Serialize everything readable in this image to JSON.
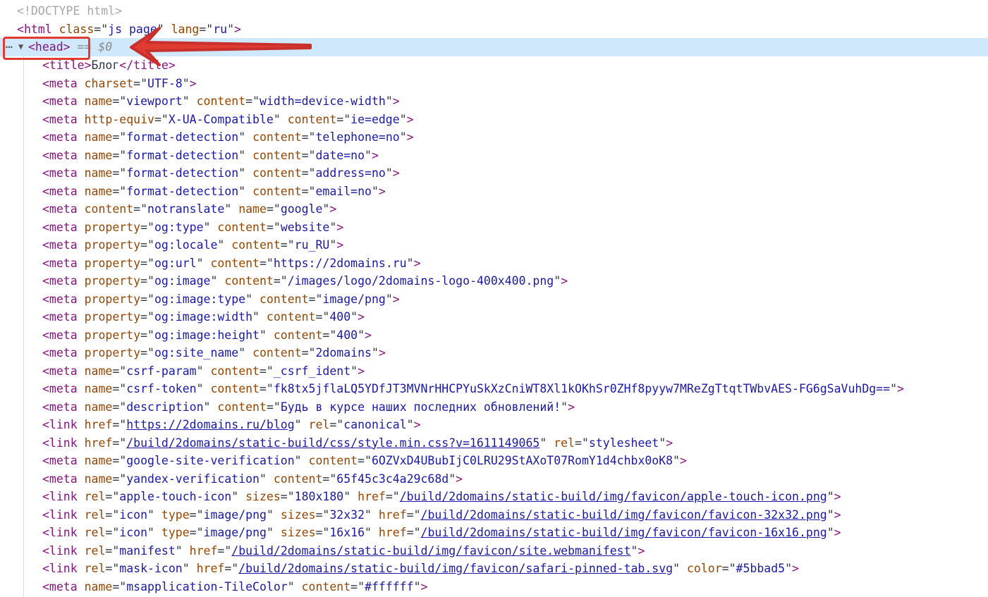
{
  "doctype": "<!DOCTYPE html>",
  "html_open": {
    "tag": "html",
    "class_value": "js page",
    "lang_value": "ru"
  },
  "head_node": {
    "tag": "<head>",
    "console_ref": "== $0"
  },
  "title_node": {
    "text": "Блог"
  },
  "nodes": [
    [
      [
        "t",
        "<meta "
      ],
      [
        "a",
        "charset"
      ],
      [
        "e",
        "=\""
      ],
      [
        "v",
        "UTF-8"
      ],
      [
        "e",
        "\""
      ],
      [
        "t",
        ">"
      ]
    ],
    [
      [
        "t",
        "<meta "
      ],
      [
        "a",
        "name"
      ],
      [
        "e",
        "=\""
      ],
      [
        "v",
        "viewport"
      ],
      [
        "e",
        "\" "
      ],
      [
        "a",
        "content"
      ],
      [
        "e",
        "=\""
      ],
      [
        "v",
        "width=device-width"
      ],
      [
        "e",
        "\""
      ],
      [
        "t",
        ">"
      ]
    ],
    [
      [
        "t",
        "<meta "
      ],
      [
        "a",
        "http-equiv"
      ],
      [
        "e",
        "=\""
      ],
      [
        "v",
        "X-UA-Compatible"
      ],
      [
        "e",
        "\" "
      ],
      [
        "a",
        "content"
      ],
      [
        "e",
        "=\""
      ],
      [
        "v",
        "ie=edge"
      ],
      [
        "e",
        "\""
      ],
      [
        "t",
        ">"
      ]
    ],
    [
      [
        "t",
        "<meta "
      ],
      [
        "a",
        "name"
      ],
      [
        "e",
        "=\""
      ],
      [
        "v",
        "format-detection"
      ],
      [
        "e",
        "\" "
      ],
      [
        "a",
        "content"
      ],
      [
        "e",
        "=\""
      ],
      [
        "v",
        "telephone=no"
      ],
      [
        "e",
        "\""
      ],
      [
        "t",
        ">"
      ]
    ],
    [
      [
        "t",
        "<meta "
      ],
      [
        "a",
        "name"
      ],
      [
        "e",
        "=\""
      ],
      [
        "v",
        "format-detection"
      ],
      [
        "e",
        "\" "
      ],
      [
        "a",
        "content"
      ],
      [
        "e",
        "=\""
      ],
      [
        "v",
        "date=no"
      ],
      [
        "e",
        "\""
      ],
      [
        "t",
        ">"
      ]
    ],
    [
      [
        "t",
        "<meta "
      ],
      [
        "a",
        "name"
      ],
      [
        "e",
        "=\""
      ],
      [
        "v",
        "format-detection"
      ],
      [
        "e",
        "\" "
      ],
      [
        "a",
        "content"
      ],
      [
        "e",
        "=\""
      ],
      [
        "v",
        "address=no"
      ],
      [
        "e",
        "\""
      ],
      [
        "t",
        ">"
      ]
    ],
    [
      [
        "t",
        "<meta "
      ],
      [
        "a",
        "name"
      ],
      [
        "e",
        "=\""
      ],
      [
        "v",
        "format-detection"
      ],
      [
        "e",
        "\" "
      ],
      [
        "a",
        "content"
      ],
      [
        "e",
        "=\""
      ],
      [
        "v",
        "email=no"
      ],
      [
        "e",
        "\""
      ],
      [
        "t",
        ">"
      ]
    ],
    [
      [
        "t",
        "<meta "
      ],
      [
        "a",
        "content"
      ],
      [
        "e",
        "=\""
      ],
      [
        "v",
        "notranslate"
      ],
      [
        "e",
        "\" "
      ],
      [
        "a",
        "name"
      ],
      [
        "e",
        "=\""
      ],
      [
        "v",
        "google"
      ],
      [
        "e",
        "\""
      ],
      [
        "t",
        ">"
      ]
    ],
    [
      [
        "t",
        "<meta "
      ],
      [
        "a",
        "property"
      ],
      [
        "e",
        "=\""
      ],
      [
        "v",
        "og:type"
      ],
      [
        "e",
        "\" "
      ],
      [
        "a",
        "content"
      ],
      [
        "e",
        "=\""
      ],
      [
        "v",
        "website"
      ],
      [
        "e",
        "\""
      ],
      [
        "t",
        ">"
      ]
    ],
    [
      [
        "t",
        "<meta "
      ],
      [
        "a",
        "property"
      ],
      [
        "e",
        "=\""
      ],
      [
        "v",
        "og:locale"
      ],
      [
        "e",
        "\" "
      ],
      [
        "a",
        "content"
      ],
      [
        "e",
        "=\""
      ],
      [
        "v",
        "ru_RU"
      ],
      [
        "e",
        "\""
      ],
      [
        "t",
        ">"
      ]
    ],
    [
      [
        "t",
        "<meta "
      ],
      [
        "a",
        "property"
      ],
      [
        "e",
        "=\""
      ],
      [
        "v",
        "og:url"
      ],
      [
        "e",
        "\" "
      ],
      [
        "a",
        "content"
      ],
      [
        "e",
        "=\""
      ],
      [
        "v",
        "https://2domains.ru"
      ],
      [
        "e",
        "\""
      ],
      [
        "t",
        ">"
      ]
    ],
    [
      [
        "t",
        "<meta "
      ],
      [
        "a",
        "property"
      ],
      [
        "e",
        "=\""
      ],
      [
        "v",
        "og:image"
      ],
      [
        "e",
        "\" "
      ],
      [
        "a",
        "content"
      ],
      [
        "e",
        "=\""
      ],
      [
        "v",
        "/images/logo/2domains-logo-400x400.png"
      ],
      [
        "e",
        "\""
      ],
      [
        "t",
        ">"
      ]
    ],
    [
      [
        "t",
        "<meta "
      ],
      [
        "a",
        "property"
      ],
      [
        "e",
        "=\""
      ],
      [
        "v",
        "og:image:type"
      ],
      [
        "e",
        "\" "
      ],
      [
        "a",
        "content"
      ],
      [
        "e",
        "=\""
      ],
      [
        "v",
        "image/png"
      ],
      [
        "e",
        "\""
      ],
      [
        "t",
        ">"
      ]
    ],
    [
      [
        "t",
        "<meta "
      ],
      [
        "a",
        "property"
      ],
      [
        "e",
        "=\""
      ],
      [
        "v",
        "og:image:width"
      ],
      [
        "e",
        "\" "
      ],
      [
        "a",
        "content"
      ],
      [
        "e",
        "=\""
      ],
      [
        "v",
        "400"
      ],
      [
        "e",
        "\""
      ],
      [
        "t",
        ">"
      ]
    ],
    [
      [
        "t",
        "<meta "
      ],
      [
        "a",
        "property"
      ],
      [
        "e",
        "=\""
      ],
      [
        "v",
        "og:image:height"
      ],
      [
        "e",
        "\" "
      ],
      [
        "a",
        "content"
      ],
      [
        "e",
        "=\""
      ],
      [
        "v",
        "400"
      ],
      [
        "e",
        "\""
      ],
      [
        "t",
        ">"
      ]
    ],
    [
      [
        "t",
        "<meta "
      ],
      [
        "a",
        "property"
      ],
      [
        "e",
        "=\""
      ],
      [
        "v",
        "og:site_name"
      ],
      [
        "e",
        "\" "
      ],
      [
        "a",
        "content"
      ],
      [
        "e",
        "=\""
      ],
      [
        "v",
        "2domains"
      ],
      [
        "e",
        "\""
      ],
      [
        "t",
        ">"
      ]
    ],
    [
      [
        "t",
        "<meta "
      ],
      [
        "a",
        "name"
      ],
      [
        "e",
        "=\""
      ],
      [
        "v",
        "csrf-param"
      ],
      [
        "e",
        "\" "
      ],
      [
        "a",
        "content"
      ],
      [
        "e",
        "=\""
      ],
      [
        "v",
        "_csrf_ident"
      ],
      [
        "e",
        "\""
      ],
      [
        "t",
        ">"
      ]
    ],
    [
      [
        "t",
        "<meta "
      ],
      [
        "a",
        "name"
      ],
      [
        "e",
        "=\""
      ],
      [
        "v",
        "csrf-token"
      ],
      [
        "e",
        "\" "
      ],
      [
        "a",
        "content"
      ],
      [
        "e",
        "=\""
      ],
      [
        "v",
        "fk8tx5jflaLQ5YDfJT3MVNrHHCPYuSkXzCniWT8Xl1kOKhSr0ZHf8pyyw7MReZgTtqtTWbvAES-FG6gSaVuhDg=="
      ],
      [
        "e",
        "\""
      ],
      [
        "t",
        ">"
      ]
    ],
    [
      [
        "t",
        "<meta "
      ],
      [
        "a",
        "name"
      ],
      [
        "e",
        "=\""
      ],
      [
        "v",
        "description"
      ],
      [
        "e",
        "\" "
      ],
      [
        "a",
        "content"
      ],
      [
        "e",
        "=\""
      ],
      [
        "v",
        "Будь в курсе наших последних обновлений!"
      ],
      [
        "e",
        "\""
      ],
      [
        "t",
        ">"
      ]
    ],
    [
      [
        "t",
        "<link "
      ],
      [
        "a",
        "href"
      ],
      [
        "e",
        "=\""
      ],
      [
        "l",
        "https://2domains.ru/blog"
      ],
      [
        "e",
        "\" "
      ],
      [
        "a",
        "rel"
      ],
      [
        "e",
        "=\""
      ],
      [
        "v",
        "canonical"
      ],
      [
        "e",
        "\""
      ],
      [
        "t",
        ">"
      ]
    ],
    [
      [
        "t",
        "<link "
      ],
      [
        "a",
        "href"
      ],
      [
        "e",
        "=\""
      ],
      [
        "l",
        "/build/2domains/static-build/css/style.min.css?v=1611149065"
      ],
      [
        "e",
        "\" "
      ],
      [
        "a",
        "rel"
      ],
      [
        "e",
        "=\""
      ],
      [
        "v",
        "stylesheet"
      ],
      [
        "e",
        "\""
      ],
      [
        "t",
        ">"
      ]
    ],
    [
      [
        "t",
        "<meta "
      ],
      [
        "a",
        "name"
      ],
      [
        "e",
        "=\""
      ],
      [
        "v",
        "google-site-verification"
      ],
      [
        "e",
        "\" "
      ],
      [
        "a",
        "content"
      ],
      [
        "e",
        "=\""
      ],
      [
        "v",
        "6OZVxD4UBubIjC0LRU29StAXoT07RomY1d4chbx0oK8"
      ],
      [
        "e",
        "\""
      ],
      [
        "t",
        ">"
      ]
    ],
    [
      [
        "t",
        "<meta "
      ],
      [
        "a",
        "name"
      ],
      [
        "e",
        "=\""
      ],
      [
        "v",
        "yandex-verification"
      ],
      [
        "e",
        "\" "
      ],
      [
        "a",
        "content"
      ],
      [
        "e",
        "=\""
      ],
      [
        "v",
        "65f45c3c4a29c68d"
      ],
      [
        "e",
        "\""
      ],
      [
        "t",
        ">"
      ]
    ],
    [
      [
        "t",
        "<link "
      ],
      [
        "a",
        "rel"
      ],
      [
        "e",
        "=\""
      ],
      [
        "v",
        "apple-touch-icon"
      ],
      [
        "e",
        "\" "
      ],
      [
        "a",
        "sizes"
      ],
      [
        "e",
        "=\""
      ],
      [
        "v",
        "180x180"
      ],
      [
        "e",
        "\" "
      ],
      [
        "a",
        "href"
      ],
      [
        "e",
        "=\""
      ],
      [
        "l",
        "/build/2domains/static-build/img/favicon/apple-touch-icon.png"
      ],
      [
        "e",
        "\""
      ],
      [
        "t",
        ">"
      ]
    ],
    [
      [
        "t",
        "<link "
      ],
      [
        "a",
        "rel"
      ],
      [
        "e",
        "=\""
      ],
      [
        "v",
        "icon"
      ],
      [
        "e",
        "\" "
      ],
      [
        "a",
        "type"
      ],
      [
        "e",
        "=\""
      ],
      [
        "v",
        "image/png"
      ],
      [
        "e",
        "\" "
      ],
      [
        "a",
        "sizes"
      ],
      [
        "e",
        "=\""
      ],
      [
        "v",
        "32x32"
      ],
      [
        "e",
        "\" "
      ],
      [
        "a",
        "href"
      ],
      [
        "e",
        "=\""
      ],
      [
        "l",
        "/build/2domains/static-build/img/favicon/favicon-32x32.png"
      ],
      [
        "e",
        "\""
      ],
      [
        "t",
        ">"
      ]
    ],
    [
      [
        "t",
        "<link "
      ],
      [
        "a",
        "rel"
      ],
      [
        "e",
        "=\""
      ],
      [
        "v",
        "icon"
      ],
      [
        "e",
        "\" "
      ],
      [
        "a",
        "type"
      ],
      [
        "e",
        "=\""
      ],
      [
        "v",
        "image/png"
      ],
      [
        "e",
        "\" "
      ],
      [
        "a",
        "sizes"
      ],
      [
        "e",
        "=\""
      ],
      [
        "v",
        "16x16"
      ],
      [
        "e",
        "\" "
      ],
      [
        "a",
        "href"
      ],
      [
        "e",
        "=\""
      ],
      [
        "l",
        "/build/2domains/static-build/img/favicon/favicon-16x16.png"
      ],
      [
        "e",
        "\""
      ],
      [
        "t",
        ">"
      ]
    ],
    [
      [
        "t",
        "<link "
      ],
      [
        "a",
        "rel"
      ],
      [
        "e",
        "=\""
      ],
      [
        "v",
        "manifest"
      ],
      [
        "e",
        "\" "
      ],
      [
        "a",
        "href"
      ],
      [
        "e",
        "=\""
      ],
      [
        "l",
        "/build/2domains/static-build/img/favicon/site.webmanifest"
      ],
      [
        "e",
        "\""
      ],
      [
        "t",
        ">"
      ]
    ],
    [
      [
        "t",
        "<link "
      ],
      [
        "a",
        "rel"
      ],
      [
        "e",
        "=\""
      ],
      [
        "v",
        "mask-icon"
      ],
      [
        "e",
        "\" "
      ],
      [
        "a",
        "href"
      ],
      [
        "e",
        "=\""
      ],
      [
        "l",
        "/build/2domains/static-build/img/favicon/safari-pinned-tab.svg"
      ],
      [
        "e",
        "\" "
      ],
      [
        "a",
        "color"
      ],
      [
        "e",
        "=\""
      ],
      [
        "v",
        "#5bbad5"
      ],
      [
        "e",
        "\""
      ],
      [
        "t",
        ">"
      ]
    ],
    [
      [
        "t",
        "<meta "
      ],
      [
        "a",
        "name"
      ],
      [
        "e",
        "=\""
      ],
      [
        "v",
        "msapplication-TileColor"
      ],
      [
        "e",
        "\" "
      ],
      [
        "a",
        "content"
      ],
      [
        "e",
        "=\""
      ],
      [
        "v",
        "#ffffff"
      ],
      [
        "e",
        "\""
      ],
      [
        "t",
        ">"
      ]
    ]
  ],
  "colors": {
    "tag": "#881280",
    "attr": "#994500",
    "value": "#1a1aa6",
    "selection": "#cfe8fc",
    "annotation": "#e03c31"
  },
  "icons": {
    "expand": "triangle-down-icon",
    "more": "ellipsis-icon",
    "annotation": "red-arrow"
  }
}
